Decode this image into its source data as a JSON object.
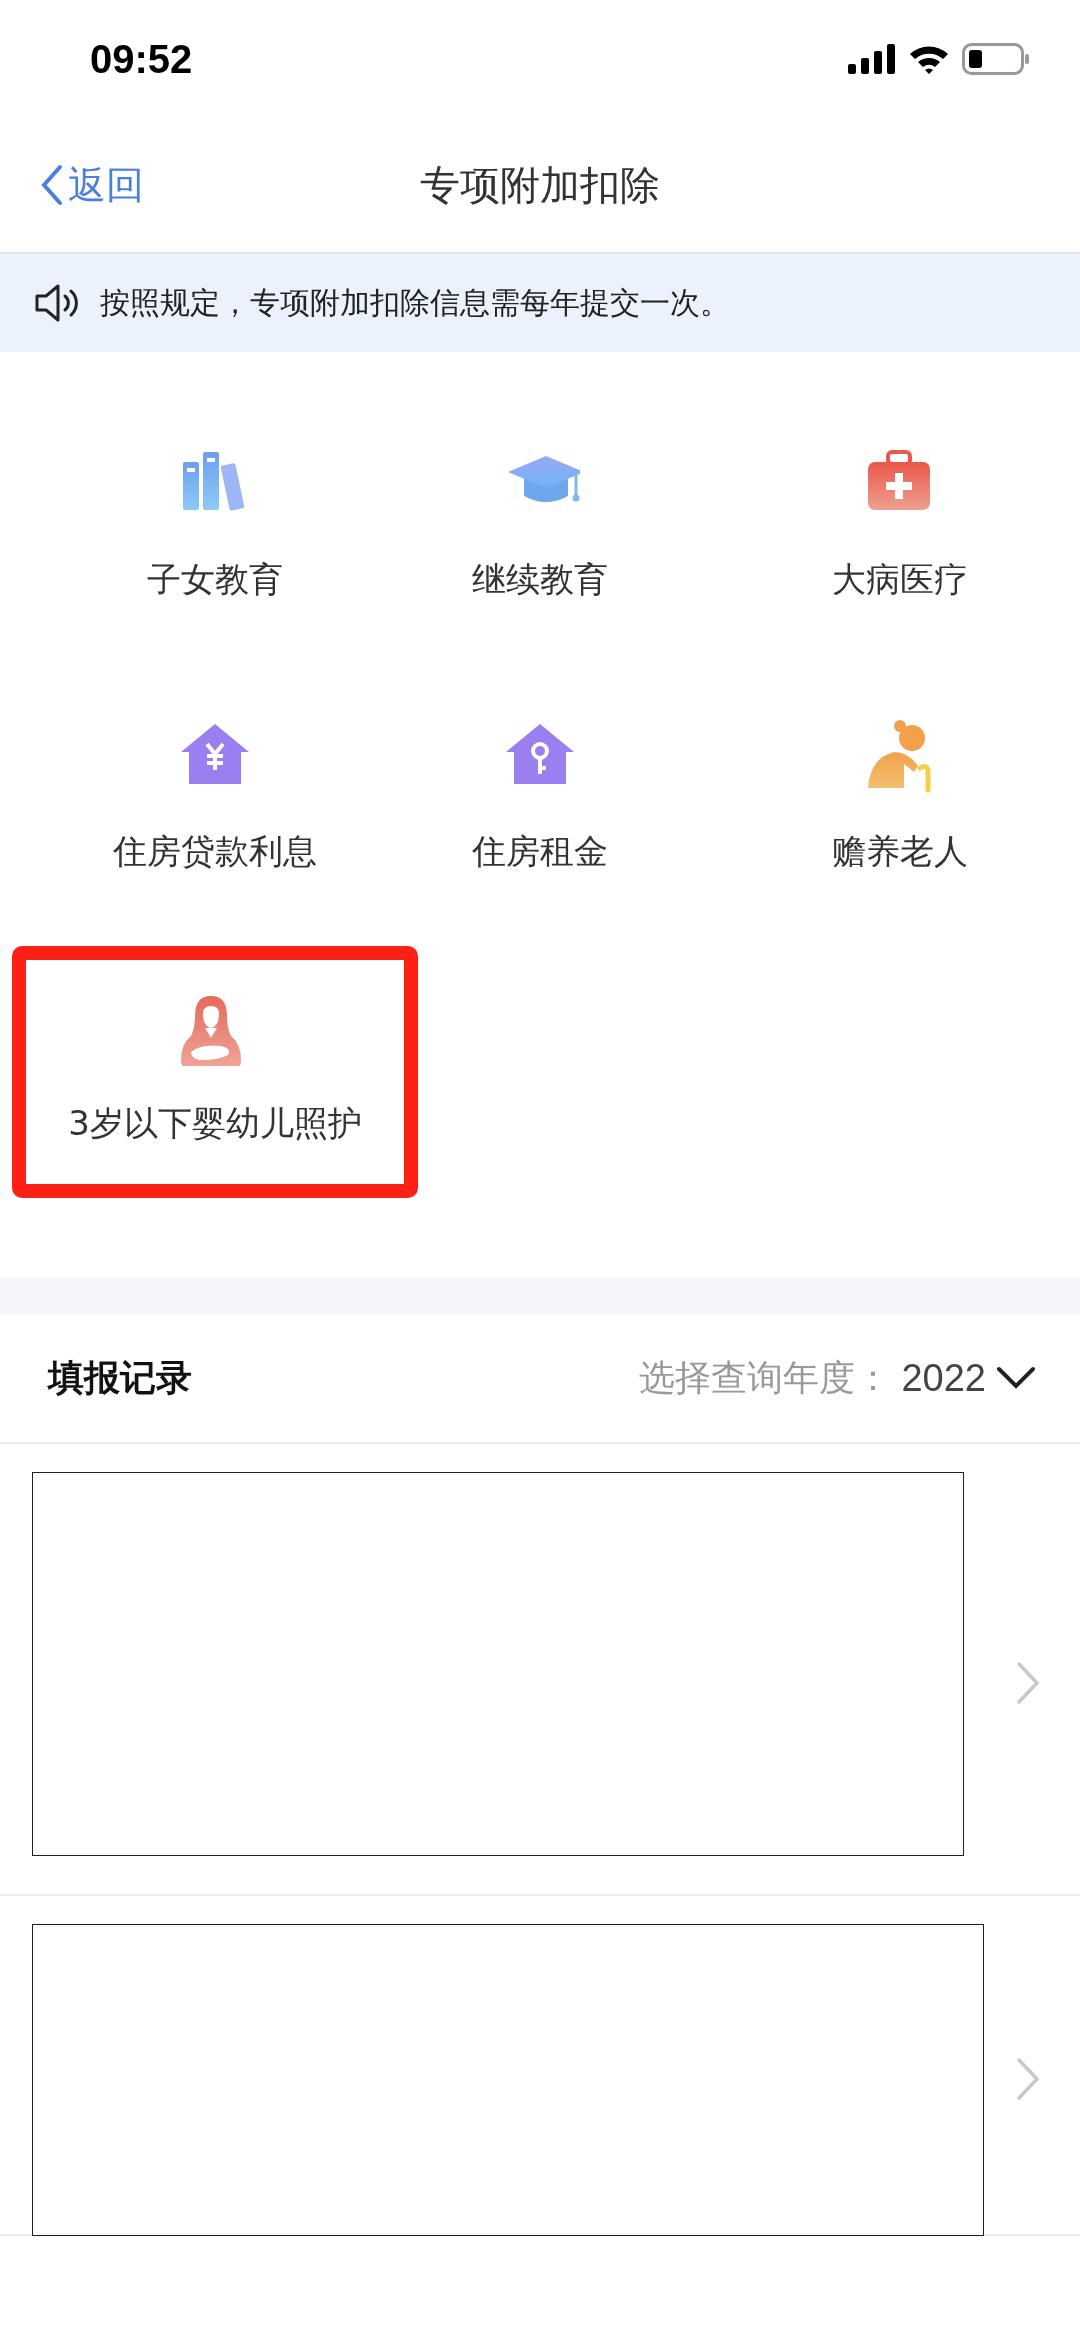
{
  "status_bar": {
    "time": "09:52"
  },
  "nav": {
    "back": "返回",
    "title": "专项附加扣除"
  },
  "notice": {
    "text": "按照规定，专项附加扣除信息需每年提交一次。"
  },
  "categories": [
    {
      "label": "子女教育",
      "kind": "books",
      "highlighted": false
    },
    {
      "label": "继续教育",
      "kind": "cap",
      "highlighted": false
    },
    {
      "label": "大病医疗",
      "kind": "medkit",
      "highlighted": false
    },
    {
      "label": "住房贷款利息",
      "kind": "house-yen",
      "highlighted": false
    },
    {
      "label": "住房租金",
      "kind": "house-key",
      "highlighted": false
    },
    {
      "label": "赡养老人",
      "kind": "elder",
      "highlighted": false
    },
    {
      "label": "3岁以下婴幼儿照护",
      "kind": "mother",
      "highlighted": true
    }
  ],
  "records": {
    "title": "填报记录",
    "year_label": "选择查询年度：",
    "year": "2022",
    "items": [
      {
        "redacted": true
      },
      {
        "redacted": true
      }
    ]
  }
}
